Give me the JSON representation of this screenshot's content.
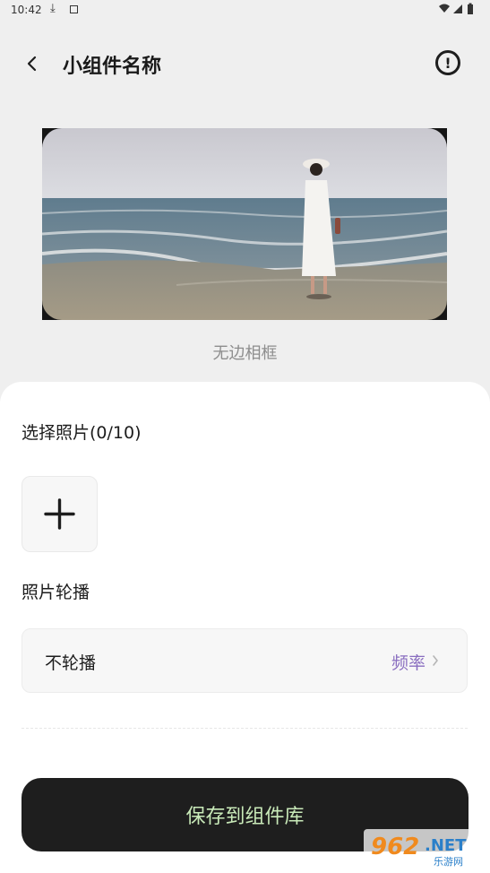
{
  "status_bar": {
    "time": "10:42",
    "icons": [
      "download-icon",
      "a-icon",
      "wifi-icon",
      "signal-icon",
      "battery-icon"
    ]
  },
  "header": {
    "title": "小组件名称",
    "back_icon": "chevron-left-icon",
    "info_icon": "exclamation-circle-icon",
    "info_glyph": "!"
  },
  "preview": {
    "frame_label": "无边相框"
  },
  "sheet": {
    "photo_section_title": "选择照片(0/10)",
    "add_photo_icon": "plus-icon",
    "carousel_section_title": "照片轮播",
    "carousel_value": "不轮播",
    "frequency_label": "频率",
    "save_button": "保存到组件库"
  },
  "watermark": {
    "number": "962",
    "suffix": ".NET",
    "subtitle": "乐游网"
  },
  "colors": {
    "background": "#efefef",
    "sheet": "#ffffff",
    "save_button_bg": "#1e1e1e",
    "save_button_text": "#c9eab9",
    "accent": "#8a6ec0"
  }
}
